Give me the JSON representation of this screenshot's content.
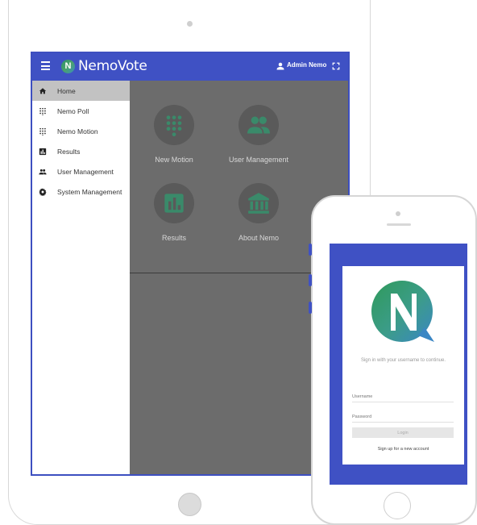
{
  "tablet": {
    "app_bar": {
      "brand": "NemoVote",
      "logo_letter": "N",
      "user_label": "Admin Nemo",
      "bar_color": "#3f51c4",
      "icons": {
        "menu": "menu-icon",
        "user": "account-icon",
        "fullscreen": "fullscreen-icon"
      }
    },
    "sidebar": {
      "items": [
        {
          "label": "Home",
          "icon": "home-icon",
          "active": true
        },
        {
          "label": "Nemo Poll",
          "icon": "dialpad-icon",
          "active": false
        },
        {
          "label": "Nemo Motion",
          "icon": "dialpad-icon",
          "active": false
        },
        {
          "label": "Results",
          "icon": "bar-chart-icon",
          "active": false
        },
        {
          "label": "User Management",
          "icon": "group-icon",
          "active": false
        },
        {
          "label": "System Management",
          "icon": "gear-icon",
          "active": false
        }
      ]
    },
    "tiles": [
      {
        "label": "New Motion",
        "icon": "dialpad-icon"
      },
      {
        "label": "User Management",
        "icon": "group-icon"
      },
      {
        "label": "Results",
        "icon": "bar-chart-icon"
      },
      {
        "label": "About Nemo",
        "icon": "bank-icon"
      }
    ],
    "overlay_color": "#6c6c6c"
  },
  "phone": {
    "login": {
      "logo_letter": "N",
      "prompt": "Sign in with your username to continue.",
      "username_placeholder": "Username",
      "password_placeholder": "Password",
      "login_button": "Login",
      "signup_link": "Sign up for a new account"
    }
  }
}
